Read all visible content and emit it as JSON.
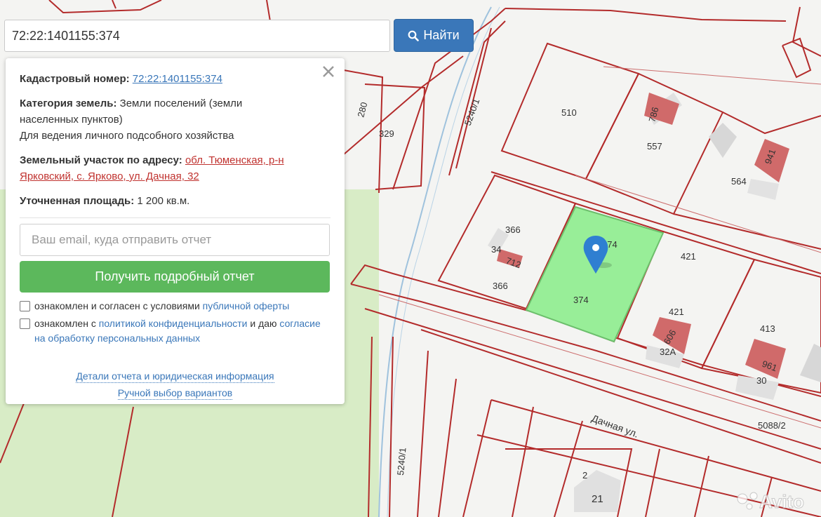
{
  "search": {
    "value": "72:22:1401155:374",
    "button_label": "Найти"
  },
  "panel": {
    "cadastral_label": "Кадастровый номер:",
    "cadastral_value": "72:22:1401155:374",
    "category_label": "Категория земель:",
    "category_value_line1": "Земли поселений (земли",
    "category_value_line2": "населенных пунктов)",
    "usage": "Для ведения личного подсобного хозяйства",
    "address_label": "Земельный участок по адресу:",
    "address_line1": "обл. Тюменская, р-н",
    "address_line2": "Ярковский, с. Ярково, ул. Дачная, 32",
    "area_label": "Уточненная площадь:",
    "area_value": "1 200 кв.м.",
    "email_placeholder": "Ваш email, куда отправить отчет",
    "report_button": "Получить подробный отчет",
    "consent1_text": "ознакомлен и согласен с условиями",
    "consent1_link": "публичной оферты",
    "consent2_text_a": "ознакомлен с",
    "consent2_link_a": "политикой конфиденциальности",
    "consent2_text_b": "и даю",
    "consent2_link_b": "согласие на обработку персональных данных",
    "details_link": "Детали отчета и юридическая информация",
    "manual_link": "Ручной выбор вариантов"
  },
  "map": {
    "labels": {
      "l280": "280",
      "l329": "329",
      "l5240_1_top": "5240/1",
      "l510": "510",
      "l786": "786",
      "l557": "557",
      "l941": "941",
      "l564": "564",
      "l366a": "366",
      "l34": "34",
      "l712": "712",
      "l366b": "366",
      "l374a": "374",
      "l374b": "374",
      "l421a": "421",
      "l421b": "421",
      "l606": "606",
      "l32a": "32А",
      "l413": "413",
      "l961": "961",
      "l30": "30",
      "l5088_2": "5088/2",
      "street": "Дачная ул.",
      "l5240_1_bottom": "5240/1",
      "l2": "2",
      "l21": "21"
    },
    "watermark": "Avito",
    "colors": {
      "boundary": "#b32b2b",
      "selected_fill": "#98ee98",
      "marker": "#2f7fd1",
      "green_zone": "#d8ecc6"
    }
  }
}
